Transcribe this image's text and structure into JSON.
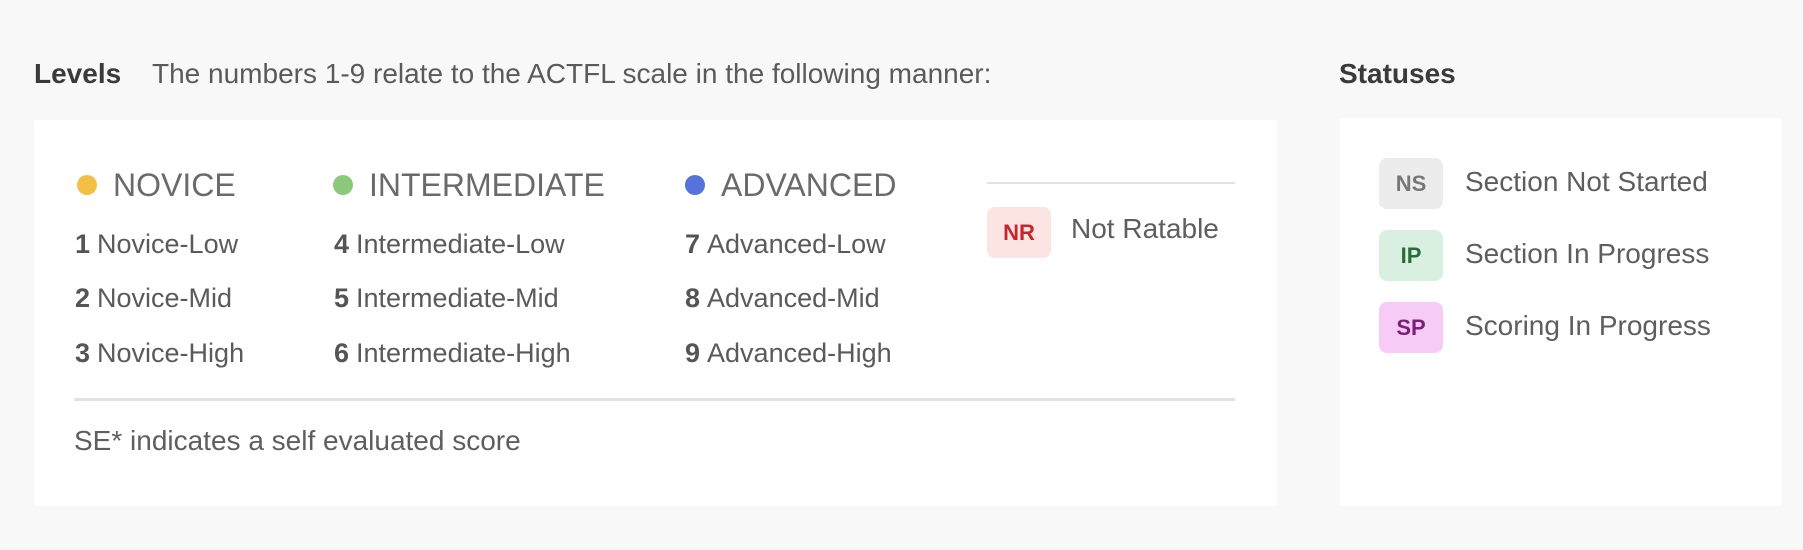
{
  "levels": {
    "title": "Levels",
    "description": "The numbers 1-9 relate to the ACTFL scale in the following manner:",
    "groups": [
      {
        "name": "NOVICE",
        "color": "#f4bf45",
        "items": [
          {
            "number": "1",
            "label": "Novice-Low"
          },
          {
            "number": "2",
            "label": "Novice-Mid"
          },
          {
            "number": "3",
            "label": "Novice-High"
          }
        ]
      },
      {
        "name": "INTERMEDIATE",
        "color": "#8cc97a",
        "items": [
          {
            "number": "4",
            "label": "Intermediate-Low"
          },
          {
            "number": "5",
            "label": "Intermediate-Mid"
          },
          {
            "number": "6",
            "label": "Intermediate-High"
          }
        ]
      },
      {
        "name": "ADVANCED",
        "color": "#5672db",
        "items": [
          {
            "number": "7",
            "label": "Advanced-Low"
          },
          {
            "number": "8",
            "label": "Advanced-Mid"
          },
          {
            "number": "9",
            "label": "Advanced-High"
          }
        ]
      }
    ],
    "not_ratable": {
      "badge": "NR",
      "label": "Not Ratable",
      "bg": "#fbe4e1",
      "fg": "#c4262e"
    },
    "note": "SE* indicates a self evaluated score"
  },
  "statuses": {
    "title": "Statuses",
    "items": [
      {
        "badge": "NS",
        "label": "Section Not Started",
        "bg": "#ececec",
        "fg": "#777777"
      },
      {
        "badge": "IP",
        "label": "Section In Progress",
        "bg": "#d9f0e1",
        "fg": "#2b6a3d"
      },
      {
        "badge": "SP",
        "label": "Scoring In Progress",
        "bg": "#f6ccf6",
        "fg": "#7c1f7c"
      }
    ]
  }
}
